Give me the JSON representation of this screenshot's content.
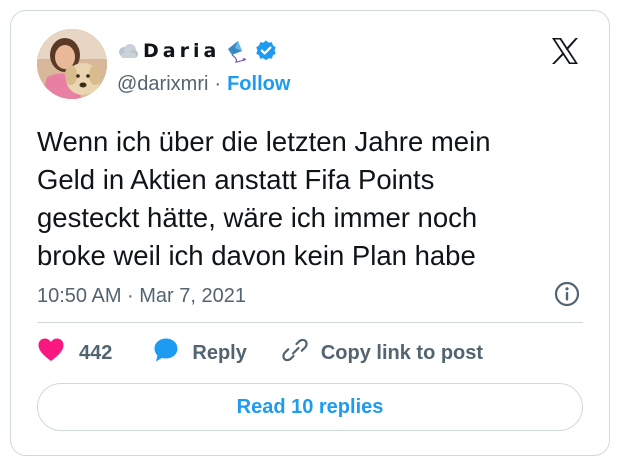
{
  "author": {
    "display_name": "Daria",
    "handle": "@darixmri",
    "follow_label": "Follow",
    "verified": true,
    "name_prefix_icon": "cloud-icon",
    "name_suffix_icon": "kite-icon"
  },
  "tweet": {
    "text_lines": [
      "Wenn ich über die letzten Jahre mein",
      "Geld in Aktien anstatt Fifa Points",
      "gesteckt hätte, wäre ich immer noch",
      "broke weil ich davon kein Plan habe"
    ],
    "timestamp": "10:50 AM · Mar 7, 2021"
  },
  "actions": {
    "like_count": "442",
    "reply_label": "Reply",
    "copy_label": "Copy link to post"
  },
  "read_replies_label": "Read 10 replies",
  "colors": {
    "accent": "#1d9bf0",
    "like": "#f91880",
    "text": "#0f1419",
    "muted": "#536471",
    "border": "#cfd9de"
  },
  "icons": [
    "x-logo-icon",
    "verified-badge-icon",
    "info-icon",
    "heart-icon",
    "reply-bubble-icon",
    "link-icon"
  ]
}
